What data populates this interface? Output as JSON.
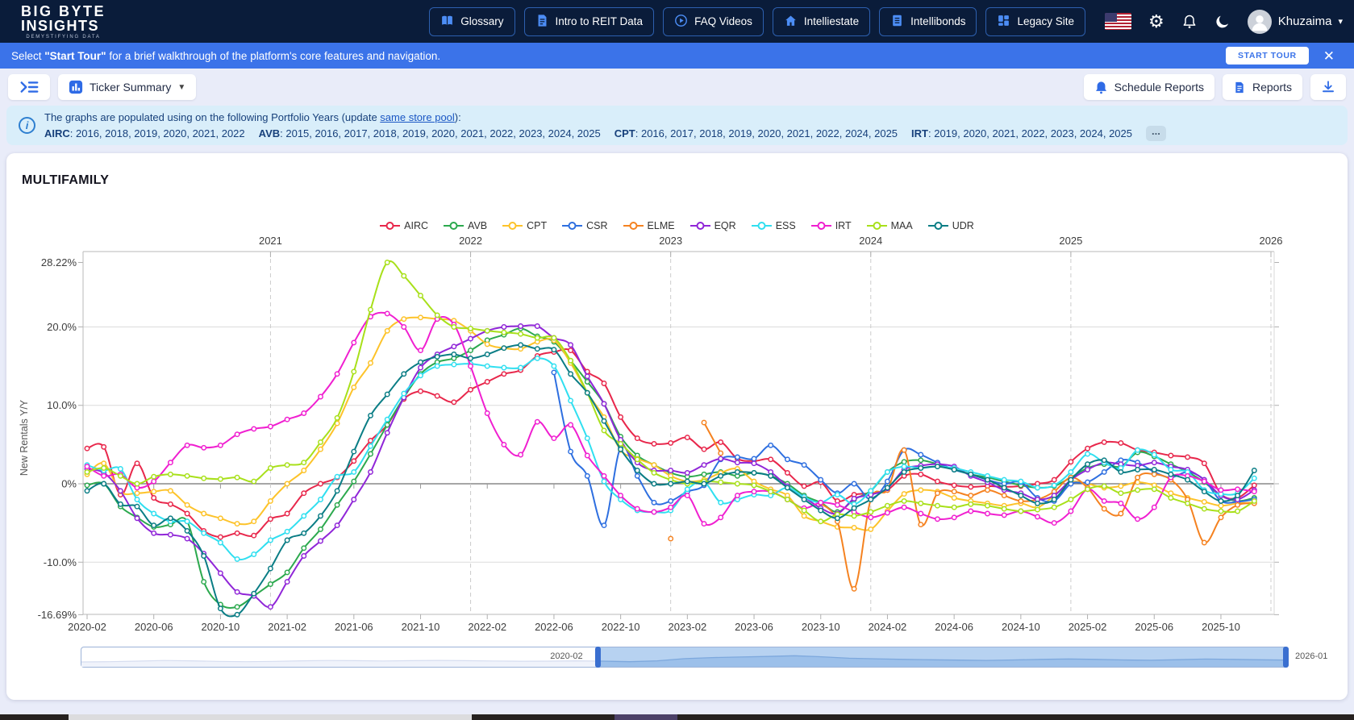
{
  "navbar": {
    "logo_line1": "BIG BYTE",
    "logo_line2": "INSIGHTS",
    "logo_tagline": "DEMYSTIFYING DATA",
    "buttons": [
      {
        "label": "Glossary",
        "icon": "book-icon"
      },
      {
        "label": "Intro to REIT Data",
        "icon": "document-icon"
      },
      {
        "label": "FAQ Videos",
        "icon": "play-circle-icon"
      },
      {
        "label": "Intelliestate",
        "icon": "home-icon"
      },
      {
        "label": "Intellibonds",
        "icon": "notes-icon"
      },
      {
        "label": "Legacy Site",
        "icon": "grid-icon"
      }
    ],
    "user_name": "Khuzaima"
  },
  "banner": {
    "text_prefix": "Select ",
    "text_bold": "\"Start Tour\"",
    "text_suffix": " for a brief walkthrough of the platform's core features and navigation.",
    "start_tour_label": "START TOUR"
  },
  "toolbar": {
    "ticker_summary_label": "Ticker Summary",
    "schedule_reports_label": "Schedule Reports",
    "reports_label": "Reports"
  },
  "info_bar": {
    "line1_prefix": "The graphs are populated using on the following Portfolio Years (update ",
    "line1_link": "same store pool",
    "line1_suffix": "):",
    "portfolio_years": [
      {
        "ticker": "AIRC",
        "years": "2016, 2018, 2019, 2020, 2021, 2022"
      },
      {
        "ticker": "AVB",
        "years": "2015, 2016, 2017, 2018, 2019, 2020, 2021, 2022, 2023, 2024, 2025"
      },
      {
        "ticker": "CPT",
        "years": "2016, 2017, 2018, 2019, 2020, 2021, 2022, 2024, 2025"
      },
      {
        "ticker": "IRT",
        "years": "2019, 2020, 2021, 2022, 2023, 2024, 2025"
      }
    ],
    "more_label": "..."
  },
  "chart_data": {
    "type": "line",
    "title": "MULTIFAMILY",
    "x_start_month": "2020-02",
    "x_step_months": 1,
    "y_axis": {
      "title": "New Rentals Y/Y",
      "min": -16.69,
      "max": 28.22,
      "ticks": [
        {
          "label": "28.22%",
          "value": 28.22,
          "grid": "none"
        },
        {
          "label": "20.0%",
          "value": 20,
          "grid": "light"
        },
        {
          "label": "10.0%",
          "value": 10,
          "grid": "light"
        },
        {
          "label": "0%",
          "value": 0,
          "grid": "zero"
        },
        {
          "label": "-10.0%",
          "value": -10,
          "grid": "light"
        },
        {
          "label": "-16.69%",
          "value": -16.69,
          "grid": "frame"
        }
      ]
    },
    "x_axis_top": {
      "years": [
        {
          "label": "2021",
          "month_index": 11
        },
        {
          "label": "2022",
          "month_index": 23
        },
        {
          "label": "2023",
          "month_index": 35
        },
        {
          "label": "2024",
          "month_index": 47
        },
        {
          "label": "2025",
          "month_index": 59
        },
        {
          "label": "2026",
          "month_index": 71
        }
      ]
    },
    "x_axis_bottom": {
      "ticks": [
        {
          "label": "2020-02",
          "month_index": 0
        },
        {
          "label": "2020-06",
          "month_index": 4
        },
        {
          "label": "2020-10",
          "month_index": 8
        },
        {
          "label": "2021-02",
          "month_index": 12
        },
        {
          "label": "2021-06",
          "month_index": 16
        },
        {
          "label": "2021-10",
          "month_index": 20
        },
        {
          "label": "2022-02",
          "month_index": 24
        },
        {
          "label": "2022-06",
          "month_index": 28
        },
        {
          "label": "2022-10",
          "month_index": 32
        },
        {
          "label": "2023-02",
          "month_index": 36
        },
        {
          "label": "2023-06",
          "month_index": 40
        },
        {
          "label": "2023-10",
          "month_index": 44
        },
        {
          "label": "2024-02",
          "month_index": 48
        },
        {
          "label": "2024-06",
          "month_index": 52
        },
        {
          "label": "2024-10",
          "month_index": 56
        },
        {
          "label": "2025-02",
          "month_index": 60
        },
        {
          "label": "2025-06",
          "month_index": 64
        },
        {
          "label": "2025-10",
          "month_index": 68
        }
      ]
    },
    "series": [
      {
        "name": "AIRC",
        "color": "#e8274b",
        "values": [
          4.5,
          4.7,
          -1.4,
          2.6,
          -1.8,
          -2.6,
          -3.8,
          -6.0,
          -6.8,
          -6.3,
          -6.6,
          -4.5,
          -3.8,
          -1.2,
          0.0,
          0.8,
          2.9,
          5.5,
          7.5,
          10.8,
          11.8,
          11.2,
          10.4,
          12.0,
          13.0,
          14.0,
          14.5,
          16.3,
          16.8,
          17.0,
          14.3,
          12.8,
          8.5,
          5.8,
          5.1,
          5.2,
          5.9,
          4.4,
          5.3,
          3.2,
          2.9,
          3.1,
          1.4,
          -0.3,
          0.2,
          -2.2,
          -1.4,
          -1.2,
          -0.8,
          1.0,
          1.2,
          0.3,
          -0.2,
          -0.4,
          -0.3,
          -0.4,
          -0.3,
          0.0,
          0.5,
          2.8,
          4.5,
          5.3,
          5.2,
          4.3,
          4.0,
          3.6,
          3.4,
          2.6,
          -1.3,
          -1.8,
          -0.2
        ]
      },
      {
        "name": "AVB",
        "color": "#2ca94e",
        "values": [
          -0.2,
          0.0,
          -2.9,
          -4.3,
          -5.5,
          -5.2,
          -4.8,
          -12.5,
          -15.4,
          -15.7,
          -14.3,
          -12.8,
          -11.3,
          -8.2,
          -5.8,
          -2.7,
          0.3,
          3.8,
          7.5,
          11.0,
          14.0,
          15.5,
          16.0,
          17.0,
          18.3,
          19.0,
          19.8,
          18.8,
          18.1,
          15.7,
          13.0,
          10.2,
          6.0,
          3.6,
          2.4,
          1.4,
          0.9,
          1.2,
          1.5,
          1.0,
          1.4,
          1.0,
          0.0,
          -1.5,
          -2.4,
          -3.6,
          -2.0,
          -0.9,
          1.5,
          2.8,
          3.0,
          2.5,
          1.8,
          1.2,
          0.8,
          0.3,
          -0.2,
          -0.5,
          -0.3,
          0.8,
          2.0,
          2.5,
          2.2,
          4.0,
          3.5,
          2.5,
          1.5,
          0.2,
          -1.5,
          -2.2,
          -1.8
        ]
      },
      {
        "name": "CPT",
        "color": "#fdc32a",
        "values": [
          1.2,
          2.6,
          -1.0,
          -1.2,
          -1.0,
          -0.9,
          -2.7,
          -3.8,
          -4.4,
          -5.1,
          -4.8,
          -2.2,
          0.0,
          1.7,
          4.4,
          7.7,
          12.3,
          15.4,
          19.5,
          21.0,
          21.2,
          21.0,
          20.8,
          19.5,
          17.8,
          17.3,
          17.2,
          18.1,
          18.3,
          15.4,
          11.6,
          8.5,
          4.3,
          3.2,
          2.4,
          1.0,
          0.3,
          0.5,
          1.4,
          1.9,
          0.3,
          -0.7,
          -1.5,
          -4.1,
          -4.8,
          -5.5,
          -5.6,
          -5.8,
          -3.5,
          -1.3,
          -0.8,
          -1.0,
          -1.8,
          -2.2,
          -2.5,
          -2.8,
          -2.5,
          -3.0,
          -1.5,
          0.2,
          0.0,
          -0.5,
          -0.3,
          0.2,
          -0.2,
          -1.2,
          -1.8,
          -2.3,
          -2.8,
          -2.5,
          -2.4
        ]
      },
      {
        "name": "CSR",
        "color": "#2e6fe0",
        "values": [
          null,
          null,
          null,
          null,
          null,
          null,
          null,
          null,
          null,
          null,
          null,
          null,
          null,
          null,
          null,
          null,
          null,
          null,
          null,
          null,
          null,
          null,
          null,
          null,
          null,
          null,
          null,
          null,
          14.2,
          4.1,
          1.0,
          -5.3,
          4.6,
          1.0,
          -2.4,
          -2.2,
          -1.0,
          -0.2,
          3.1,
          3.4,
          3.2,
          4.9,
          3.1,
          2.4,
          0.5,
          -1.2,
          0.0,
          -2.0,
          0.3,
          4.3,
          3.7,
          2.7,
          1.8,
          1.2,
          0.5,
          0.0,
          0.2,
          -1.8,
          -2.2,
          0.0,
          0.2,
          1.5,
          3.0,
          2.7,
          1.5,
          0.8,
          1.5,
          0.5,
          -2.2,
          -2.3,
          -2.0
        ]
      },
      {
        "name": "ELME",
        "color": "#f58220",
        "values": [
          null,
          null,
          null,
          null,
          null,
          null,
          null,
          null,
          null,
          null,
          null,
          null,
          null,
          null,
          null,
          null,
          null,
          null,
          null,
          null,
          null,
          null,
          null,
          null,
          null,
          null,
          null,
          null,
          null,
          null,
          null,
          null,
          null,
          null,
          null,
          -7.0,
          null,
          7.8,
          3.9,
          null,
          null,
          null,
          null,
          null,
          -2.5,
          -4.8,
          -13.4,
          -2.0,
          -0.8,
          4.3,
          -5.2,
          -1.2,
          -1.0,
          -1.5,
          -0.8,
          -1.5,
          -2.2,
          -2.0,
          -1.0,
          0.8,
          -0.5,
          -3.2,
          -3.8,
          0.8,
          1.2,
          0.5,
          -2.0,
          -7.5,
          -4.3,
          -2.7,
          -2.5
        ]
      },
      {
        "name": "EQR",
        "color": "#9026d8",
        "values": [
          1.9,
          1.4,
          -0.9,
          -4.4,
          -6.3,
          -6.5,
          -7.0,
          -8.9,
          -11.4,
          -13.8,
          -14.3,
          -15.7,
          -12.5,
          -9.2,
          -7.3,
          -5.3,
          -2.0,
          1.5,
          6.5,
          11.0,
          14.8,
          16.5,
          17.5,
          18.5,
          19.5,
          20.0,
          20.1,
          20.1,
          18.6,
          17.7,
          13.7,
          10.2,
          5.6,
          2.7,
          1.7,
          1.7,
          1.4,
          2.4,
          3.2,
          2.7,
          2.6,
          1.5,
          -0.3,
          -1.7,
          -3.1,
          -3.8,
          -1.9,
          -1.4,
          -0.6,
          1.8,
          2.3,
          2.5,
          2.2,
          1.0,
          0.2,
          -0.8,
          -1.2,
          -2.0,
          -1.5,
          0.5,
          1.8,
          2.7,
          2.5,
          2.3,
          2.7,
          2.2,
          1.8,
          0.5,
          -1.5,
          -2.0,
          -0.8
        ]
      },
      {
        "name": "ESS",
        "color": "#30dff0",
        "values": [
          2.4,
          1.7,
          1.9,
          -2.0,
          -3.8,
          -4.8,
          -4.8,
          -6.3,
          -7.5,
          -9.6,
          -9.0,
          -7.2,
          -6.1,
          -4.1,
          -2.0,
          0.9,
          1.5,
          4.8,
          8.2,
          11.5,
          13.8,
          15.0,
          15.2,
          15.3,
          15.0,
          14.8,
          14.8,
          16.0,
          15.0,
          10.6,
          5.8,
          0.3,
          -2.0,
          -3.4,
          -3.6,
          -3.4,
          -0.7,
          0.2,
          -2.4,
          -2.0,
          -1.4,
          -1.5,
          -0.5,
          -1.7,
          -2.4,
          -1.4,
          -2.6,
          -0.9,
          1.5,
          2.2,
          2.0,
          2.2,
          2.0,
          1.5,
          1.0,
          0.5,
          0.3,
          -0.5,
          -0.2,
          1.5,
          3.8,
          2.7,
          2.0,
          4.3,
          3.7,
          1.8,
          1.5,
          -0.8,
          -1.3,
          -1.2,
          0.7
        ]
      },
      {
        "name": "IRT",
        "color": "#f01fd0",
        "values": [
          2.2,
          1.0,
          1.2,
          -0.5,
          0.3,
          2.7,
          4.9,
          4.6,
          4.9,
          6.3,
          7.0,
          7.3,
          8.2,
          9.0,
          11.1,
          14.0,
          18.0,
          21.3,
          21.7,
          20.0,
          17.0,
          21.0,
          20.3,
          15.0,
          9.0,
          5.0,
          3.7,
          7.9,
          5.8,
          7.5,
          3.6,
          1.0,
          -1.5,
          -3.2,
          -3.6,
          -3.0,
          -1.5,
          -5.1,
          -4.3,
          -1.5,
          -1.0,
          -1.0,
          -2.0,
          -3.1,
          -2.4,
          -2.7,
          -3.6,
          -4.3,
          -3.7,
          -3.0,
          -3.8,
          -4.5,
          -4.3,
          -3.5,
          -3.8,
          -4.0,
          -3.5,
          -4.2,
          -5.0,
          -3.5,
          -0.7,
          -2.2,
          -2.5,
          -4.5,
          -3.0,
          0.8,
          1.0,
          0.3,
          -0.8,
          -0.7,
          -1.0
        ]
      },
      {
        "name": "MAA",
        "color": "#a8e01a",
        "values": [
          1.5,
          2.0,
          1.0,
          0.0,
          0.9,
          1.2,
          1.0,
          0.7,
          0.6,
          0.8,
          0.3,
          2.0,
          2.4,
          2.7,
          5.3,
          8.4,
          14.3,
          22.2,
          28.22,
          26.5,
          24.0,
          21.5,
          20.0,
          19.8,
          19.5,
          19.3,
          19.1,
          18.6,
          18.6,
          15.7,
          11.6,
          6.8,
          5.1,
          3.1,
          1.4,
          0.5,
          0.0,
          0.3,
          0.2,
          0.0,
          -0.2,
          -1.0,
          -2.0,
          -3.4,
          -4.8,
          -3.9,
          -4.1,
          -3.6,
          -2.8,
          -2.2,
          -2.5,
          -2.8,
          -3.0,
          -2.6,
          -2.8,
          -3.2,
          -3.5,
          -3.3,
          -3.0,
          -2.0,
          -0.7,
          -0.3,
          -1.2,
          -0.8,
          -0.7,
          -1.8,
          -2.5,
          -3.2,
          -3.5,
          -3.5,
          -2.2
        ]
      },
      {
        "name": "UDR",
        "color": "#0a7d85",
        "values": [
          -0.9,
          0.0,
          -2.6,
          -2.9,
          -5.3,
          -4.4,
          -6.0,
          -9.2,
          -15.9,
          -16.69,
          -14.0,
          -10.8,
          -7.2,
          -6.3,
          -4.1,
          -0.9,
          4.1,
          8.7,
          11.4,
          14.0,
          15.5,
          16.2,
          16.5,
          16.0,
          16.5,
          17.3,
          17.7,
          17.2,
          17.1,
          14.0,
          11.6,
          8.0,
          4.4,
          1.7,
          0.0,
          0.0,
          0.3,
          0.0,
          1.0,
          1.5,
          1.4,
          1.0,
          -0.5,
          -2.0,
          -3.4,
          -4.4,
          -3.1,
          -2.0,
          -0.5,
          1.5,
          2.0,
          2.2,
          1.8,
          1.2,
          0.5,
          -0.5,
          -1.5,
          -2.5,
          -2.0,
          0.5,
          2.5,
          3.0,
          1.5,
          1.8,
          1.8,
          1.2,
          0.5,
          -1.0,
          -2.2,
          -1.5,
          1.7
        ]
      }
    ],
    "navigator": {
      "start_label": "2020-02",
      "end_label": "2026-01",
      "selected_start_fraction": 0.428,
      "profile": [
        0.22,
        0.24,
        0.28,
        0.32,
        0.3,
        0.26,
        0.24,
        0.26,
        0.3,
        0.32,
        0.31,
        0.29,
        0.31,
        0.33,
        0.31,
        0.29,
        0.27,
        0.28,
        0.3,
        0.28,
        0.24,
        0.3,
        0.45,
        0.52,
        0.56,
        0.6,
        0.65,
        0.58,
        0.48,
        0.44,
        0.4,
        0.37,
        0.35,
        0.33,
        0.36,
        0.4,
        0.43,
        0.4,
        0.36,
        0.34,
        0.38,
        0.42,
        0.4,
        0.37,
        0.35
      ]
    }
  }
}
